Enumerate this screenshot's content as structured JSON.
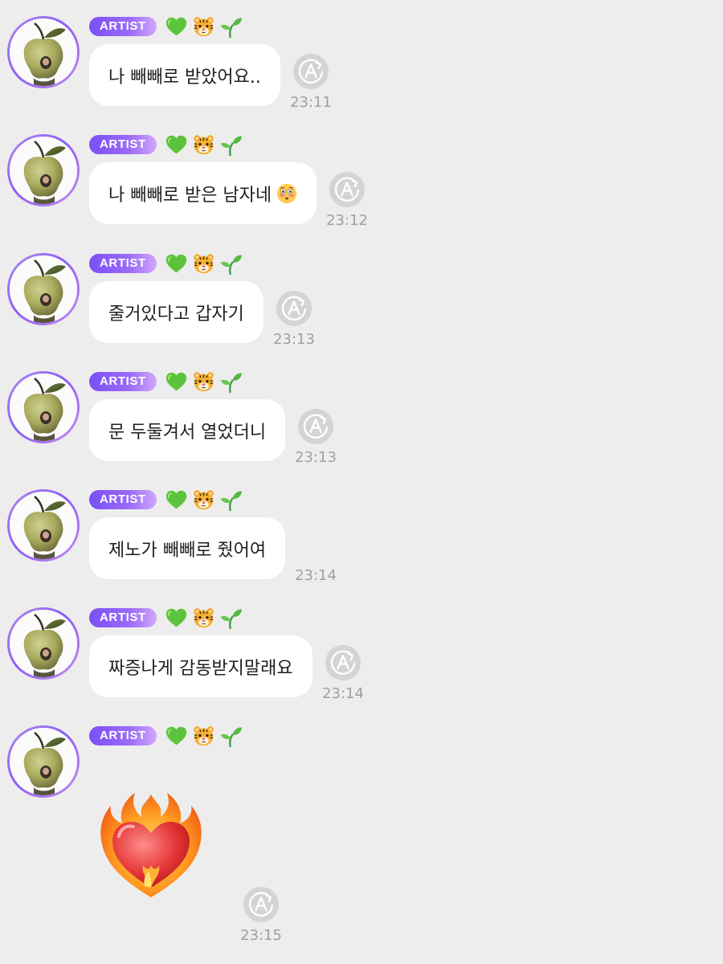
{
  "badge_label": "ARTIST",
  "badge_emojis": [
    "green-heart",
    "tiger-face",
    "seedling"
  ],
  "avatar_description": "apple-avatar",
  "colors": {
    "background": "#ededed",
    "bubble": "#ffffff",
    "badge_start": "#7a4ff5",
    "badge_end": "#d2a7fb",
    "time": "#a0a0a0"
  },
  "messages": [
    {
      "text": "나 빼빼로 받았어요..",
      "time": "23:11",
      "translate_icon": true
    },
    {
      "text": "나 빼빼로 받은 남자네",
      "emoji": "flushed-face",
      "time": "23:12",
      "translate_icon": true
    },
    {
      "text": "줄거있다고 갑자기",
      "time": "23:13",
      "translate_icon": true
    },
    {
      "text": "문 두둘겨서 열었더니",
      "time": "23:13",
      "translate_icon": true
    },
    {
      "text": "제노가 빼빼로 줬어여",
      "time": "23:14",
      "translate_icon": false
    },
    {
      "text": "짜증나게 감동받지말래요",
      "time": "23:14",
      "translate_icon": true
    },
    {
      "text": "",
      "sticker": "heart-on-fire",
      "time": "23:15",
      "translate_icon": true
    }
  ]
}
